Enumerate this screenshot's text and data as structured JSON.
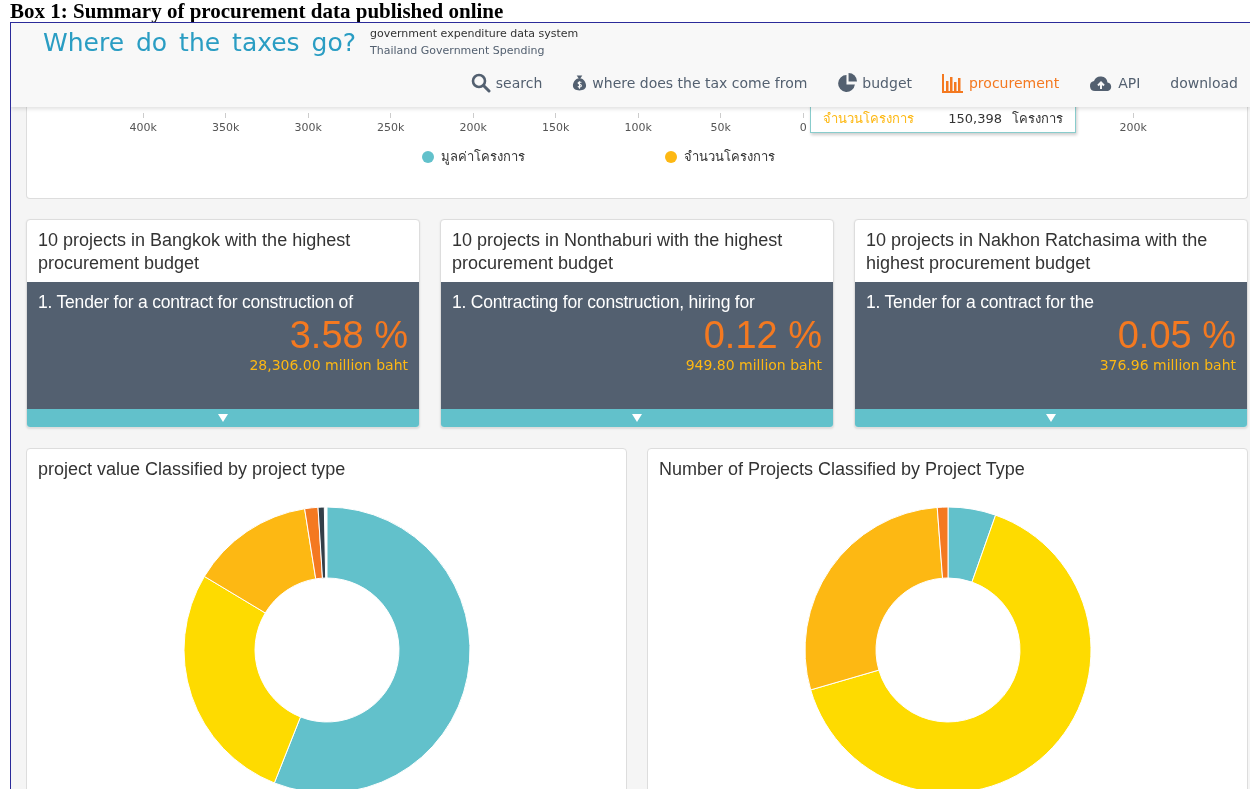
{
  "document_heading": "Box 1: Summary of procurement data published online",
  "header": {
    "title": "Where do the taxes go?",
    "subtitle_lines": [
      "government expenditure data system",
      "Thailand Government Spending"
    ],
    "nav": [
      {
        "kind": "search",
        "label": "search",
        "selected": false
      },
      {
        "kind": "moneybag",
        "label": "where does the tax come from",
        "selected": false
      },
      {
        "kind": "pie",
        "label": "budget",
        "selected": false
      },
      {
        "kind": "bars",
        "label": "procurement",
        "selected": true
      },
      {
        "kind": "cloud",
        "label": "API",
        "selected": false
      },
      {
        "kind": "none",
        "label": "download",
        "selected": false
      }
    ]
  },
  "bar_chart": {
    "axis_ticks": [
      "400k",
      "350k",
      "300k",
      "250k",
      "200k",
      "150k",
      "100k",
      "50k",
      "0"
    ],
    "axis_ticks_right": [
      "200k"
    ],
    "tooltip": {
      "label": "จำนวนโครงการ",
      "value": "150,398",
      "unit": "โครงการ"
    },
    "legend": [
      {
        "label": "มูลค่าโครงการ",
        "color": "#62c1cb"
      },
      {
        "label": "จำนวนโครงการ",
        "color": "#fdb813"
      }
    ]
  },
  "top_cards": [
    {
      "title": "10 projects in Bangkok with the highest procurement budget",
      "item": "1. Tender for a contract for construction of",
      "percent": "3.58 %",
      "amount": "28,306.00 million baht"
    },
    {
      "title": "10 projects in Nonthaburi with the highest procurement budget",
      "item": "1. Contracting for construction, hiring for",
      "percent": "0.12 %",
      "amount": "949.80 million baht"
    },
    {
      "title": "10 projects in Nakhon Ratchasima with the highest procurement budget",
      "item": "1. Tender for a contract for the",
      "percent": "0.05 %",
      "amount": "376.96 million baht"
    }
  ],
  "donut_cards": [
    {
      "title": "project value Classified by project type",
      "kind": "value"
    },
    {
      "title": "Number of Projects Classified by Project Type",
      "kind": "count"
    }
  ]
}
